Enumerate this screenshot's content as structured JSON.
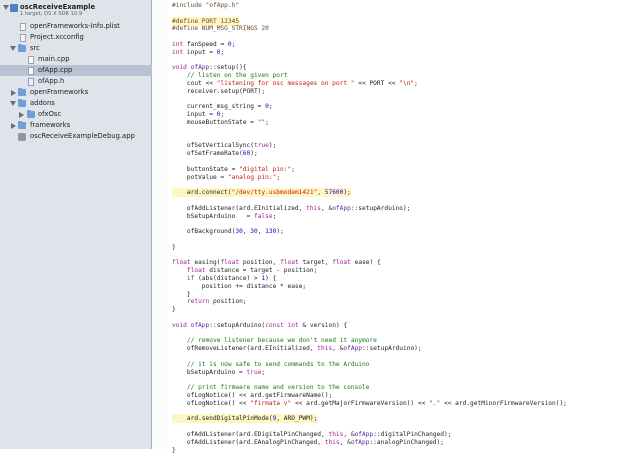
{
  "sidebar": {
    "project": {
      "name": "oscReceiveExample",
      "subtitle": "1 target, OS X SDK 10.9"
    },
    "items": [
      {
        "label": "openFrameworks-Info.plist",
        "icon": "plist-file-icon"
      },
      {
        "label": "Project.xcconfig",
        "icon": "config-file-icon"
      },
      {
        "label": "src",
        "icon": "folder-icon"
      },
      {
        "label": "main.cpp",
        "icon": "cpp-file-icon"
      },
      {
        "label": "ofApp.cpp",
        "icon": "cpp-file-icon",
        "selected": true
      },
      {
        "label": "ofApp.h",
        "icon": "header-file-icon"
      },
      {
        "label": "openFrameworks",
        "icon": "folder-icon"
      },
      {
        "label": "addons",
        "icon": "folder-icon"
      },
      {
        "label": "ofxOsc",
        "icon": "folder-icon"
      },
      {
        "label": "frameworks",
        "icon": "folder-icon"
      },
      {
        "label": "oscReceiveExampleDebug.app",
        "icon": "app-icon"
      }
    ]
  },
  "editor": {
    "file": "ofApp.cpp",
    "highlight_color": "#fff7c2",
    "lines": [
      "#include \"ofApp.h\"",
      "",
      "#define PORT 12345",
      "#define NUM_MSG_STRINGS 20",
      "",
      "int fanSpeed = 0;",
      "int input = 0;",
      "",
      "void ofApp::setup(){",
      "    // listen on the given port",
      "    cout << \"listening for osc messages on port \" << PORT << \"\\n\";",
      "    receiver.setup(PORT);",
      "",
      "    current_msg_string = 0;",
      "    input = 0;",
      "    mouseButtonState = \"\";",
      "",
      "",
      "    ofSetVerticalSync(true);",
      "    ofSetFrameRate(60);",
      "",
      "    buttonState = \"digital pin:\";",
      "    potValue = \"analog pin:\";",
      "",
      "    ard.connect(\"/dev/tty.usbmodem1421\", 57600);",
      "",
      "    ofAddListener(ard.EInitialized, this, &ofApp::setupArduino);",
      "    bSetupArduino   = false;",
      "",
      "    ofBackground(30, 30, 130);",
      "",
      "}",
      "",
      "float easing(float position, float target, float ease) {",
      "    float distance = target - position;",
      "    if (abs(distance) > 1) {",
      "        position += distance * ease;",
      "    }",
      "    return position;",
      "}",
      "",
      "void ofApp::setupArduino(const int & version) {",
      "",
      "    // remove listener because we don't need it anymore",
      "    ofRemoveListener(ard.EInitialized, this, &ofApp::setupArduino);",
      "",
      "    // it is now safe to send commands to the Arduino",
      "    bSetupArduino = true;",
      "",
      "    // print firmware name and version to the console",
      "    ofLogNotice() << ard.getFirmwareName();",
      "    ofLogNotice() << \"firmata v\" << ard.getMajorFirmwareVersion() << \".\" << ard.getMinorFirmwareVersion();",
      "",
      "    ard.sendDigitalPinMode(9, ARD_PWM);",
      "",
      "    ofAddListener(ard.EDigitalPinChanged, this, &ofApp::digitalPinChanged);",
      "    ofAddListener(ard.EAnalogPinChanged, this, &ofApp::analogPinChanged);",
      "}"
    ]
  }
}
